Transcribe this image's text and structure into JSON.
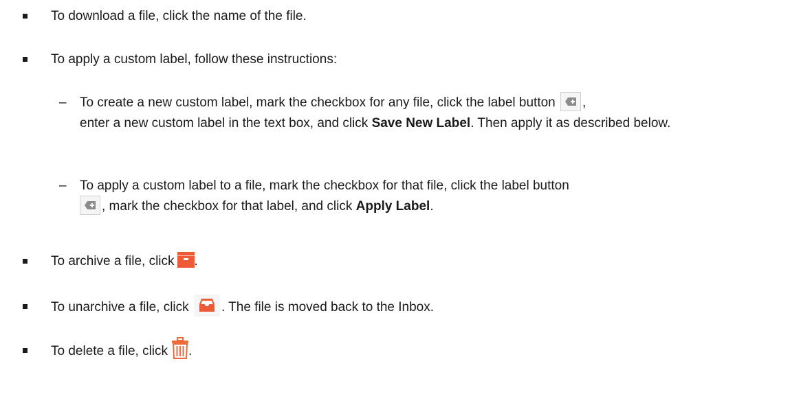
{
  "items": [
    {
      "text": "To download a file, click the name of the file."
    },
    {
      "text": "To apply a custom label, follow these instructions:"
    }
  ],
  "sub_items": [
    {
      "part1": "To create a new custom label, mark the checkbox for any file, click the label button",
      "part2": ",",
      "part3": "enter a new custom label in the text box, and click",
      "bold": "Save New Label",
      "part4": ". Then apply it as described below."
    },
    {
      "part1": "To apply a custom label to a file, mark the checkbox for that file, click the label button",
      "part2": ", mark the checkbox for that label, and click",
      "bold": "Apply Label",
      "part3": "."
    }
  ],
  "archive": {
    "before": "To archive a file, click",
    "after": "."
  },
  "unarchive": {
    "before": "To unarchive a file, click",
    "after": ". The file is moved back to the Inbox."
  },
  "delete": {
    "before": "To delete a file, click",
    "after": "."
  },
  "dash": "–",
  "colors": {
    "archive_orange": "#ee5a36",
    "trash_orange": "#ee6a3a",
    "label_icon_gray": "#8c8c8c"
  },
  "icons": [
    "label-tag-icon",
    "archive-box-icon",
    "inbox-tray-icon",
    "trash-can-icon"
  ]
}
